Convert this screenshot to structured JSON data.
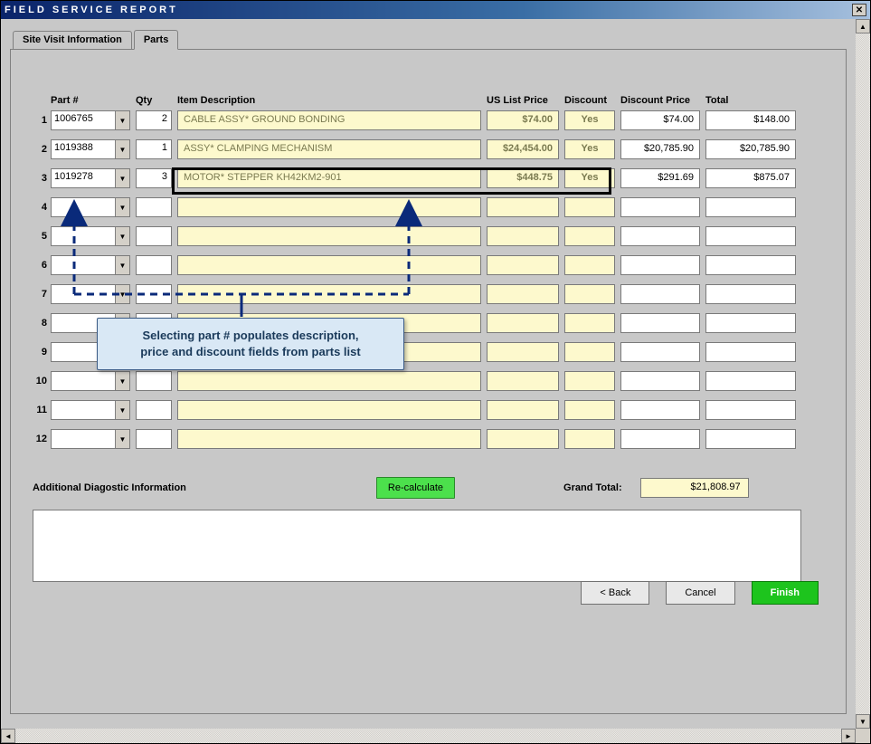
{
  "window": {
    "title": "FIELD SERVICE REPORT"
  },
  "tabs": {
    "site_visit": "Site Visit Information",
    "parts": "Parts"
  },
  "headers": {
    "part": "Part #",
    "qty": "Qty",
    "desc": "Item Description",
    "price": "US List Price",
    "disc": "Discount",
    "dprice": "Discount Price",
    "total": "Total"
  },
  "rows": [
    {
      "num": "1",
      "part": "1006765",
      "qty": "2",
      "desc": "CABLE ASSY* GROUND BONDING",
      "price": "$74.00",
      "disc": "Yes",
      "dprice": "$74.00",
      "total": "$148.00"
    },
    {
      "num": "2",
      "part": "1019388",
      "qty": "1",
      "desc": "ASSY* CLAMPING MECHANISM",
      "price": "$24,454.00",
      "disc": "Yes",
      "dprice": "$20,785.90",
      "total": "$20,785.90"
    },
    {
      "num": "3",
      "part": "1019278",
      "qty": "3",
      "desc": "MOTOR* STEPPER KH42KM2-901",
      "price": "$448.75",
      "disc": "Yes",
      "dprice": "$291.69",
      "total": "$875.07"
    },
    {
      "num": "4",
      "part": "",
      "qty": "",
      "desc": "",
      "price": "",
      "disc": "",
      "dprice": "",
      "total": ""
    },
    {
      "num": "5",
      "part": "",
      "qty": "",
      "desc": "",
      "price": "",
      "disc": "",
      "dprice": "",
      "total": ""
    },
    {
      "num": "6",
      "part": "",
      "qty": "",
      "desc": "",
      "price": "",
      "disc": "",
      "dprice": "",
      "total": ""
    },
    {
      "num": "7",
      "part": "",
      "qty": "",
      "desc": "",
      "price": "",
      "disc": "",
      "dprice": "",
      "total": ""
    },
    {
      "num": "8",
      "part": "",
      "qty": "",
      "desc": "",
      "price": "",
      "disc": "",
      "dprice": "",
      "total": ""
    },
    {
      "num": "9",
      "part": "",
      "qty": "",
      "desc": "",
      "price": "",
      "disc": "",
      "dprice": "",
      "total": ""
    },
    {
      "num": "10",
      "part": "",
      "qty": "",
      "desc": "",
      "price": "",
      "disc": "",
      "dprice": "",
      "total": ""
    },
    {
      "num": "11",
      "part": "",
      "qty": "",
      "desc": "",
      "price": "",
      "disc": "",
      "dprice": "",
      "total": ""
    },
    {
      "num": "12",
      "part": "",
      "qty": "",
      "desc": "",
      "price": "",
      "disc": "",
      "dprice": "",
      "total": ""
    }
  ],
  "callout": "Selecting part # populates description,\nprice and discount fields from parts list",
  "diag_label": "Additional Diagostic Information",
  "recalc": "Re-calculate",
  "grand_total_label": "Grand Total:",
  "grand_total_value": "$21,808.97",
  "buttons": {
    "back": "< Back",
    "cancel": "Cancel",
    "finish": "Finish"
  }
}
